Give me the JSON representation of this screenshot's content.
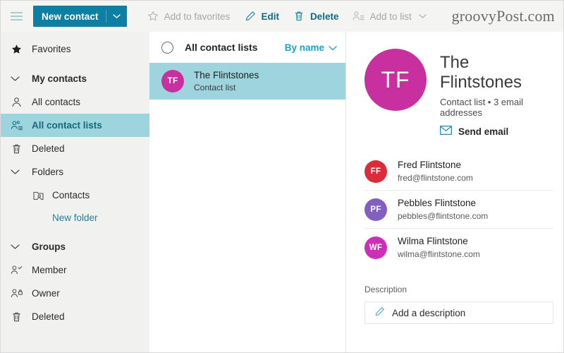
{
  "toolbar": {
    "menu_icon": "hamburger-icon",
    "new_contact": {
      "label": "New contact",
      "caret_icon": "chevron-down-icon"
    },
    "actions": [
      {
        "label": "Add to favorites",
        "icon": "star-icon",
        "enabled": false
      },
      {
        "label": "Edit",
        "icon": "pencil-icon",
        "enabled": true
      },
      {
        "label": "Delete",
        "icon": "trash-icon",
        "enabled": true
      },
      {
        "label": "Add to list",
        "icon": "add-person-icon",
        "enabled": false,
        "caret_icon": "chevron-down-icon"
      }
    ],
    "watermark": "groovyPost.com"
  },
  "sidebar": {
    "items": [
      {
        "label": "Favorites",
        "icon": "star-filled-icon"
      },
      {
        "label": "My contacts",
        "icon": "chevron-down-icon"
      },
      {
        "label": "All contacts",
        "icon": "person-icon"
      },
      {
        "label": "All contact lists",
        "icon": "people-list-icon"
      },
      {
        "label": "Deleted",
        "icon": "trash-icon"
      },
      {
        "label": "Folders",
        "icon": "chevron-down-icon"
      },
      {
        "label": "Contacts",
        "icon": "folder-person-icon"
      },
      {
        "label": "New folder",
        "icon": "none"
      },
      {
        "label": "Groups",
        "icon": "chevron-down-icon"
      },
      {
        "label": "Member",
        "icon": "person-check-icon"
      },
      {
        "label": "Owner",
        "icon": "person-lock-icon"
      },
      {
        "label": "Deleted",
        "icon": "trash-icon"
      }
    ]
  },
  "list_panel": {
    "select_all_icon": "circle-unchecked-icon",
    "title": "All contact lists",
    "sort": {
      "label": "By name",
      "icon": "chevron-down-icon"
    },
    "rows": [
      {
        "initials": "TF",
        "name": "The Flintstones",
        "subtitle": "Contact list",
        "avatar_color": "#c8309f"
      }
    ]
  },
  "detail": {
    "initials": "TF",
    "avatar_color": "#c8309f",
    "title": "The Flintstones",
    "subtitle": "Contact list • 3 email addresses",
    "send_email": {
      "label": "Send email",
      "icon": "envelope-icon"
    },
    "members": [
      {
        "initials": "FF",
        "name": "Fred Flintstone",
        "email": "fred@flintstone.com",
        "avatar_color": "#dc2b3a"
      },
      {
        "initials": "PF",
        "name": "Pebbles Flintstone",
        "email": "pebbles@flintstone.com",
        "avatar_color": "#8160c0"
      },
      {
        "initials": "WF",
        "name": "Wilma Flintstone",
        "email": "wilma@flintstone.com",
        "avatar_color": "#cf2fb6"
      }
    ],
    "description_label": "Description",
    "description_placeholder": "Add a description",
    "description_icon": "pencil-icon"
  },
  "colors": {
    "accent_teal": "#0d7fa3",
    "selection_teal": "#9ed4dd",
    "link_teal": "#1ba3c6",
    "sidebar_bg": "#f1f1f0",
    "toolbar_bg": "#f4f4f3"
  }
}
